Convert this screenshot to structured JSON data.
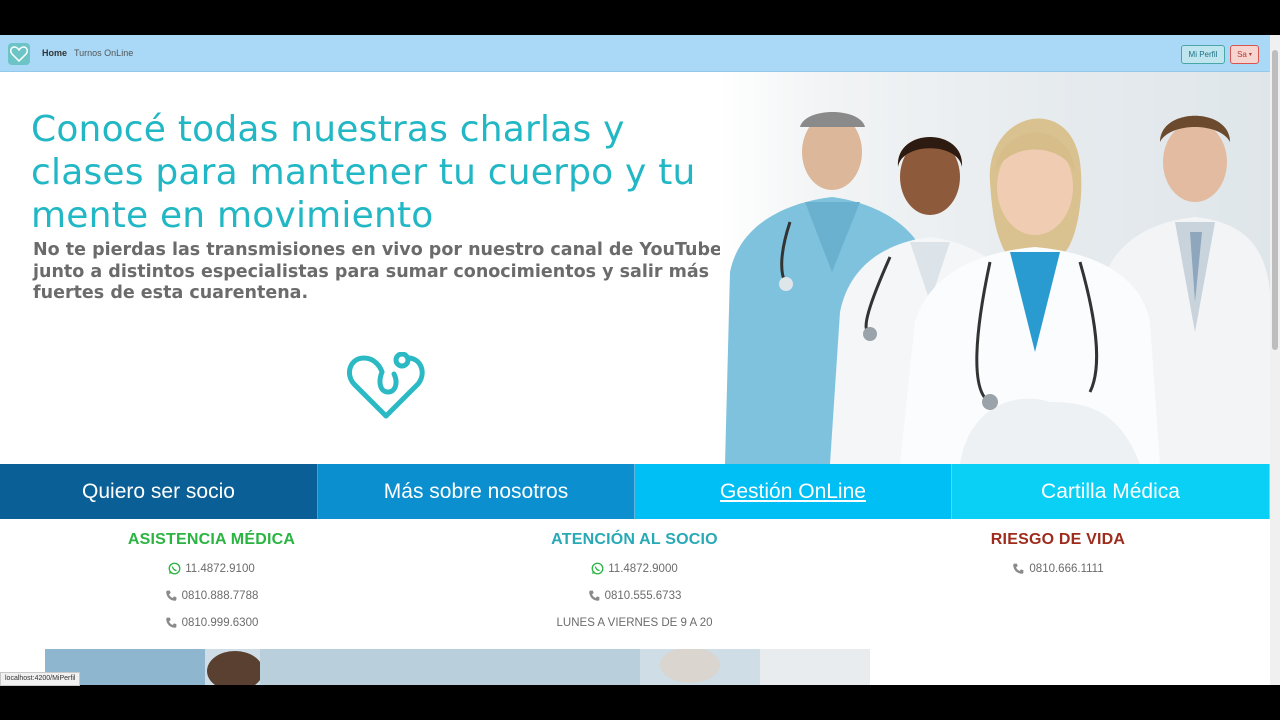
{
  "navbar": {
    "home": "Home",
    "turnos": "Turnos OnLine",
    "perfil": "Mi Perfil",
    "user": "Sa"
  },
  "hero": {
    "title": "Conocé todas nuestras charlas y clases para mantener tu cuerpo y tu mente en movimiento",
    "subtitle": "No te pierdas las transmisiones en vivo por nuestro canal de YouTube junto a distintos especialistas para sumar conocimientos y salir más fuertes de esta cuarentena."
  },
  "buttons": [
    {
      "label": "Quiero ser socio"
    },
    {
      "label": "Más sobre nosotros"
    },
    {
      "label": "Gestión OnLine"
    },
    {
      "label": "Cartilla Médica"
    }
  ],
  "contact": {
    "asistencia": {
      "title": "ASISTENCIA MÉDICA",
      "whatsapp": "11.4872.9100",
      "phone1": "0810.888.7788",
      "phone2": "0810.999.6300"
    },
    "atencion": {
      "title": "ATENCIÓN AL SOCIO",
      "whatsapp": "11.4872.9000",
      "phone1": "0810.555.6733",
      "hours": "LUNES A VIERNES DE 9 A 20"
    },
    "riesgo": {
      "title": "RIESGO DE VIDA",
      "phone1": "0810.666.1111"
    }
  },
  "status_url": "localhost:4200/MiPerfil",
  "colors": {
    "accent": "#21b7c4",
    "navbar": "#a9d9f7",
    "btn1": "#0b5f97",
    "btn2": "#0b8fcf",
    "btn3": "#00bff5",
    "btn4": "#0ad0f5"
  }
}
